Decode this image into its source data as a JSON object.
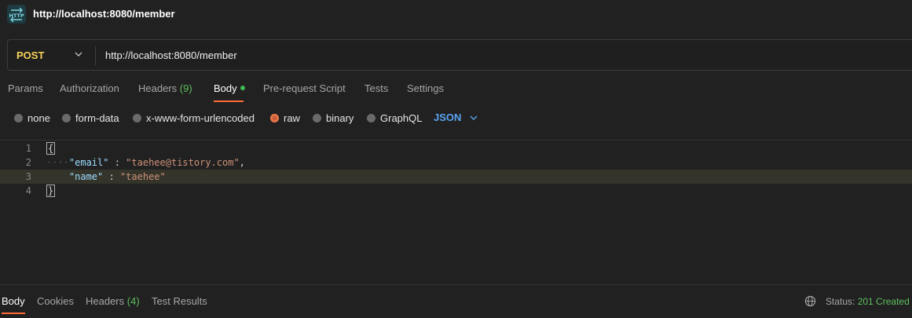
{
  "window": {
    "title": "http://localhost:8080/member",
    "icon": "http-icon"
  },
  "request": {
    "method": "POST",
    "url": "http://localhost:8080/member"
  },
  "tabs": {
    "params": "Params",
    "authorization": "Authorization",
    "headers": "Headers",
    "headers_count": "(9)",
    "body": "Body",
    "prerequest": "Pre-request Script",
    "tests": "Tests",
    "settings": "Settings",
    "active": "Body"
  },
  "body_types": {
    "none": "none",
    "form_data": "form-data",
    "urlencoded": "x-www-form-urlencoded",
    "raw": "raw",
    "binary": "binary",
    "graphql": "GraphQL",
    "selected": "raw",
    "format": "JSON"
  },
  "editor": {
    "lines": [
      {
        "num": "1",
        "open": "{"
      },
      {
        "num": "2",
        "key": "\"email\"",
        "sep": " : ",
        "value": "\"taehee@tistory.com\"",
        "trail": ","
      },
      {
        "num": "3",
        "key": "\"name\"",
        "sep": " : ",
        "value": "\"taehee\"",
        "trail": ""
      },
      {
        "num": "4",
        "close": "}"
      }
    ],
    "highlighted_line": "3"
  },
  "response": {
    "tabs": {
      "body": "Body",
      "cookies": "Cookies",
      "headers": "Headers",
      "headers_count": "(4)",
      "test_results": "Test Results"
    },
    "status_label": "Status:",
    "status_value": "201 Created"
  },
  "colors": {
    "accent": "#ff6c37",
    "method": "#f5d15a",
    "success": "#5fbf5f",
    "json_link": "#5aa2f0"
  }
}
